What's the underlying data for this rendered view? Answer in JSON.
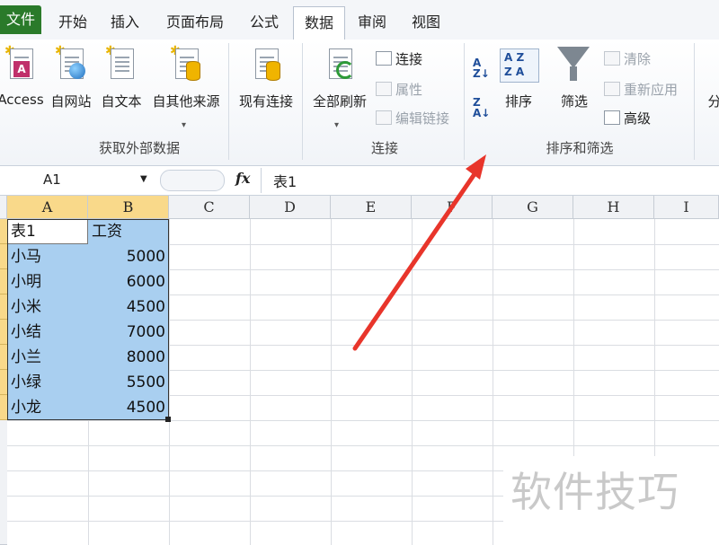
{
  "tabs": [
    "文件",
    "开始",
    "插入",
    "页面布局",
    "公式",
    "数据",
    "审阅",
    "视图"
  ],
  "active_tab": "数据",
  "ribbon": {
    "external_group": {
      "label": "获取外部数据",
      "access": "Access",
      "web": "自网站",
      "text": "自文本",
      "other": "自其他来源",
      "existing": "现有连接"
    },
    "connections_group": {
      "label": "连接",
      "refresh_all": "全部刷新",
      "connections": "连接",
      "properties": "属性",
      "edit_links": "编辑链接"
    },
    "sort_group": {
      "label": "排序和筛选",
      "sort": "排序",
      "filter": "筛选",
      "clear": "清除",
      "reapply": "重新应用",
      "advanced": "高级"
    },
    "partial_label": "分"
  },
  "formula_bar": {
    "cell_ref": "A1",
    "fx": "fx",
    "value": "表1"
  },
  "columns": [
    "A",
    "B",
    "C",
    "D",
    "E",
    "F",
    "G",
    "H",
    "I"
  ],
  "table": {
    "header": [
      "表1",
      "工资"
    ],
    "rows": [
      [
        "小马",
        "5000"
      ],
      [
        "小明",
        "6000"
      ],
      [
        "小米",
        "4500"
      ],
      [
        "小结",
        "7000"
      ],
      [
        "小兰",
        "8000"
      ],
      [
        "小绿",
        "5500"
      ],
      [
        "小龙",
        "4500"
      ]
    ]
  },
  "watermark": "软件技巧",
  "colors": {
    "selection": "#a9cff0",
    "header_highlight": "#f9d98a",
    "file_tab": "#2a7a2a",
    "annotation_arrow": "#e8352b"
  }
}
